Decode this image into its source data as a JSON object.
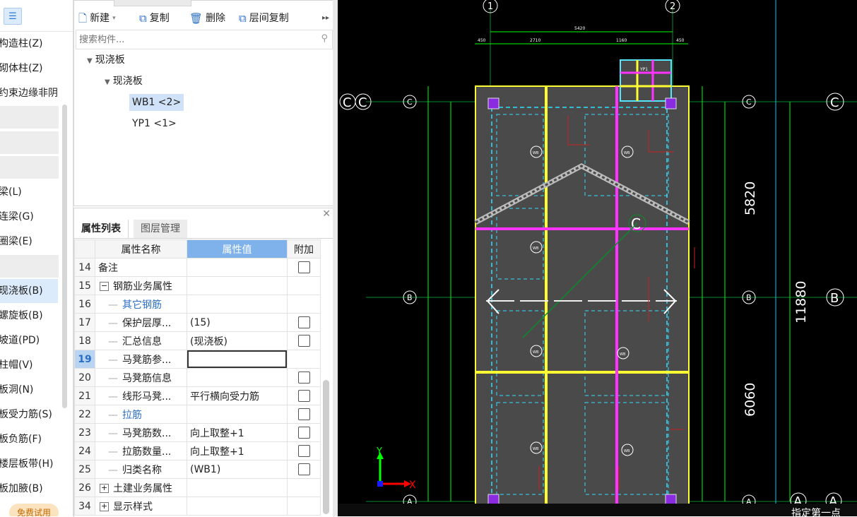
{
  "left_nav": {
    "items": [
      {
        "label": "构造柱(Z)"
      },
      {
        "label": "砌体柱(Z)"
      },
      {
        "label": "约束边缘非阴"
      },
      {
        "label": "梁(L)"
      },
      {
        "label": "连梁(G)"
      },
      {
        "label": "圈梁(E)"
      },
      {
        "label": "现浇板(B)"
      },
      {
        "label": "螺旋板(B)"
      },
      {
        "label": "坡道(PD)"
      },
      {
        "label": "柱帽(V)"
      },
      {
        "label": "板洞(N)"
      },
      {
        "label": "板受力筋(S)"
      },
      {
        "label": "板负筋(F)"
      },
      {
        "label": "楼层板带(H)"
      },
      {
        "label": "板加腋(B)"
      }
    ],
    "trial_label": "免费试用"
  },
  "toolbar": {
    "new_label": "新建",
    "copy_label": "复制",
    "delete_label": "删除",
    "floor_copy_label": "层间复制"
  },
  "search": {
    "placeholder": "搜索构件..."
  },
  "tree": {
    "root": "现浇板",
    "child": "现浇板",
    "items": [
      "WB1 <2>",
      "YP1 <1>"
    ]
  },
  "prop_panel": {
    "tabs": [
      "属性列表",
      "图层管理"
    ],
    "headers": [
      "属性名称",
      "属性值",
      "附加"
    ],
    "rows": [
      {
        "num": "14",
        "name": "备注",
        "value": "",
        "check": true
      },
      {
        "num": "15",
        "name": "钢筋业务属性",
        "value": "",
        "check": false
      },
      {
        "num": "16",
        "name": "其它钢筋",
        "value": "",
        "check": false
      },
      {
        "num": "17",
        "name": "保护层厚...",
        "value": "(15)",
        "check": true
      },
      {
        "num": "18",
        "name": "汇总信息",
        "value": "(现浇板)",
        "check": true
      },
      {
        "num": "19",
        "name": "马凳筋参...",
        "value": "",
        "check": false
      },
      {
        "num": "20",
        "name": "马凳筋信息",
        "value": "",
        "check": true
      },
      {
        "num": "21",
        "name": "线形马凳...",
        "value": "平行横向受力筋",
        "check": true
      },
      {
        "num": "22",
        "name": "拉筋",
        "value": "",
        "check": true
      },
      {
        "num": "23",
        "name": "马凳筋数...",
        "value": "向上取整+1",
        "check": true
      },
      {
        "num": "24",
        "name": "拉筋数量...",
        "value": "向上取整+1",
        "check": true
      },
      {
        "num": "25",
        "name": "归类名称",
        "value": "(WB1)",
        "check": true
      },
      {
        "num": "26",
        "name": "土建业务属性",
        "value": "",
        "check": false
      },
      {
        "num": "34",
        "name": "显示样式",
        "value": "",
        "check": false
      }
    ]
  },
  "cad": {
    "axis_top": [
      "1",
      "2"
    ],
    "grid_labels": [
      "C",
      "B",
      "A"
    ],
    "dim_top_total": "5420",
    "dims_top": [
      "450",
      "2710",
      "1160",
      "450"
    ],
    "dim_right_upper": "5820",
    "dim_right_total": "11880",
    "dim_right_lower": "6060",
    "slab_labels": [
      "WB",
      "YP1"
    ],
    "axis_y": "Y",
    "axis_x": "X",
    "status_text": "指定第一点"
  }
}
